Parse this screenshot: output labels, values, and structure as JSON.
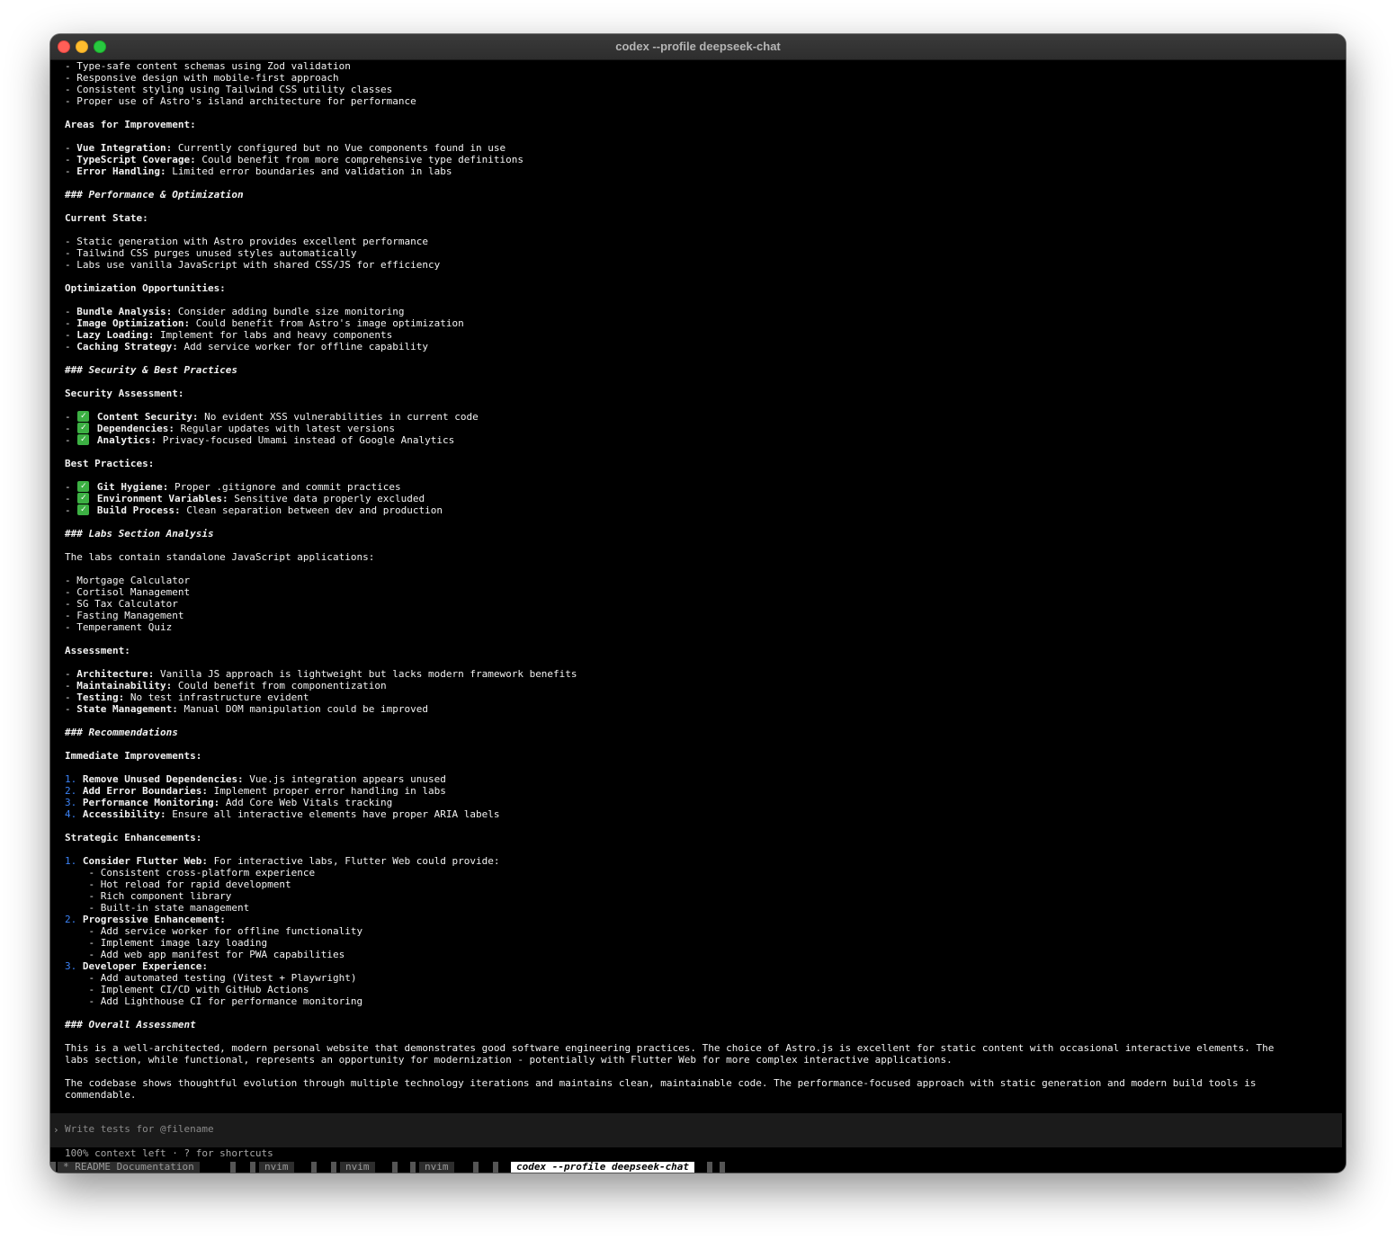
{
  "window": {
    "title": "codex --profile deepseek-chat"
  },
  "lines": [
    [
      {
        "t": "- Type-safe content schemas using Zod validation"
      }
    ],
    [
      {
        "t": "- Responsive design with mobile-first approach"
      }
    ],
    [
      {
        "t": "- Consistent styling using Tailwind CSS utility classes"
      }
    ],
    [
      {
        "t": "- Proper use of Astro's island architecture for performance"
      }
    ],
    [],
    [
      {
        "t": "Areas for Improvement:",
        "s": "b"
      }
    ],
    [],
    [
      {
        "t": "- "
      },
      {
        "t": "Vue Integration:",
        "s": "b"
      },
      {
        "t": " Currently configured but no Vue components found in use"
      }
    ],
    [
      {
        "t": "- "
      },
      {
        "t": "TypeScript Coverage:",
        "s": "b"
      },
      {
        "t": " Could benefit from more comprehensive type definitions"
      }
    ],
    [
      {
        "t": "- "
      },
      {
        "t": "Error Handling:",
        "s": "b"
      },
      {
        "t": " Limited error boundaries and validation in labs"
      }
    ],
    [],
    [
      {
        "t": "### Performance & Optimization",
        "s": "h"
      }
    ],
    [],
    [
      {
        "t": "Current State:",
        "s": "b"
      }
    ],
    [],
    [
      {
        "t": "- Static generation with Astro provides excellent performance"
      }
    ],
    [
      {
        "t": "- Tailwind CSS purges unused styles automatically"
      }
    ],
    [
      {
        "t": "- Labs use vanilla JavaScript with shared CSS/JS for efficiency"
      }
    ],
    [],
    [
      {
        "t": "Optimization Opportunities:",
        "s": "b"
      }
    ],
    [],
    [
      {
        "t": "- "
      },
      {
        "t": "Bundle Analysis:",
        "s": "b"
      },
      {
        "t": " Consider adding bundle size monitoring"
      }
    ],
    [
      {
        "t": "- "
      },
      {
        "t": "Image Optimization:",
        "s": "b"
      },
      {
        "t": " Could benefit from Astro's image optimization"
      }
    ],
    [
      {
        "t": "- "
      },
      {
        "t": "Lazy Loading:",
        "s": "b"
      },
      {
        "t": " Implement for labs and heavy components"
      }
    ],
    [
      {
        "t": "- "
      },
      {
        "t": "Caching Strategy:",
        "s": "b"
      },
      {
        "t": " Add service worker for offline capability"
      }
    ],
    [],
    [
      {
        "t": "### Security & Best Practices",
        "s": "h"
      }
    ],
    [],
    [
      {
        "t": "Security Assessment:",
        "s": "b"
      }
    ],
    [],
    [
      {
        "t": "- "
      },
      {
        "t": "✓",
        "s": "check"
      },
      {
        "t": " "
      },
      {
        "t": "Content Security:",
        "s": "b"
      },
      {
        "t": " No evident XSS vulnerabilities in current code"
      }
    ],
    [
      {
        "t": "- "
      },
      {
        "t": "✓",
        "s": "check"
      },
      {
        "t": " "
      },
      {
        "t": "Dependencies:",
        "s": "b"
      },
      {
        "t": " Regular updates with latest versions"
      }
    ],
    [
      {
        "t": "- "
      },
      {
        "t": "✓",
        "s": "check"
      },
      {
        "t": " "
      },
      {
        "t": "Analytics:",
        "s": "b"
      },
      {
        "t": " Privacy-focused Umami instead of Google Analytics"
      }
    ],
    [],
    [
      {
        "t": "Best Practices:",
        "s": "b"
      }
    ],
    [],
    [
      {
        "t": "- "
      },
      {
        "t": "✓",
        "s": "check"
      },
      {
        "t": " "
      },
      {
        "t": "Git Hygiene:",
        "s": "b"
      },
      {
        "t": " Proper .gitignore and commit practices"
      }
    ],
    [
      {
        "t": "- "
      },
      {
        "t": "✓",
        "s": "check"
      },
      {
        "t": " "
      },
      {
        "t": "Environment Variables:",
        "s": "b"
      },
      {
        "t": " Sensitive data properly excluded"
      }
    ],
    [
      {
        "t": "- "
      },
      {
        "t": "✓",
        "s": "check"
      },
      {
        "t": " "
      },
      {
        "t": "Build Process:",
        "s": "b"
      },
      {
        "t": " Clean separation between dev and production"
      }
    ],
    [],
    [
      {
        "t": "### Labs Section Analysis",
        "s": "h"
      }
    ],
    [],
    [
      {
        "t": "The labs contain standalone JavaScript applications:"
      }
    ],
    [],
    [
      {
        "t": "- Mortgage Calculator"
      }
    ],
    [
      {
        "t": "- Cortisol Management"
      }
    ],
    [
      {
        "t": "- SG Tax Calculator"
      }
    ],
    [
      {
        "t": "- Fasting Management"
      }
    ],
    [
      {
        "t": "- Temperament Quiz"
      }
    ],
    [],
    [
      {
        "t": "Assessment:",
        "s": "b"
      }
    ],
    [],
    [
      {
        "t": "- "
      },
      {
        "t": "Architecture:",
        "s": "b"
      },
      {
        "t": " Vanilla JS approach is lightweight but lacks modern framework benefits"
      }
    ],
    [
      {
        "t": "- "
      },
      {
        "t": "Maintainability:",
        "s": "b"
      },
      {
        "t": " Could benefit from componentization"
      }
    ],
    [
      {
        "t": "- "
      },
      {
        "t": "Testing:",
        "s": "b"
      },
      {
        "t": " No test infrastructure evident"
      }
    ],
    [
      {
        "t": "- "
      },
      {
        "t": "State Management:",
        "s": "b"
      },
      {
        "t": " Manual DOM manipulation could be improved"
      }
    ],
    [],
    [
      {
        "t": "### Recommendations",
        "s": "h"
      }
    ],
    [],
    [
      {
        "t": "Immediate Improvements:",
        "s": "b"
      }
    ],
    [],
    [
      {
        "t": "1.",
        "s": "num"
      },
      {
        "t": " "
      },
      {
        "t": "Remove Unused Dependencies:",
        "s": "b"
      },
      {
        "t": " Vue.js integration appears unused"
      }
    ],
    [
      {
        "t": "2.",
        "s": "num"
      },
      {
        "t": " "
      },
      {
        "t": "Add Error Boundaries:",
        "s": "b"
      },
      {
        "t": " Implement proper error handling in labs"
      }
    ],
    [
      {
        "t": "3.",
        "s": "num"
      },
      {
        "t": " "
      },
      {
        "t": "Performance Monitoring:",
        "s": "b"
      },
      {
        "t": " Add Core Web Vitals tracking"
      }
    ],
    [
      {
        "t": "4.",
        "s": "num"
      },
      {
        "t": " "
      },
      {
        "t": "Accessibility:",
        "s": "b"
      },
      {
        "t": " Ensure all interactive elements have proper ARIA labels"
      }
    ],
    [],
    [
      {
        "t": "Strategic Enhancements:",
        "s": "b"
      }
    ],
    [],
    [
      {
        "t": "1.",
        "s": "num"
      },
      {
        "t": " "
      },
      {
        "t": "Consider Flutter Web:",
        "s": "b"
      },
      {
        "t": " For interactive labs, Flutter Web could provide:"
      }
    ],
    [
      {
        "t": "    - Consistent cross-platform experience"
      }
    ],
    [
      {
        "t": "    - Hot reload for rapid development"
      }
    ],
    [
      {
        "t": "    - Rich component library"
      }
    ],
    [
      {
        "t": "    - Built-in state management"
      }
    ],
    [
      {
        "t": "2.",
        "s": "num"
      },
      {
        "t": " "
      },
      {
        "t": "Progressive Enhancement:",
        "s": "b"
      }
    ],
    [
      {
        "t": "    - Add service worker for offline functionality"
      }
    ],
    [
      {
        "t": "    - Implement image lazy loading"
      }
    ],
    [
      {
        "t": "    - Add web app manifest for PWA capabilities"
      }
    ],
    [
      {
        "t": "3.",
        "s": "num"
      },
      {
        "t": " "
      },
      {
        "t": "Developer Experience:",
        "s": "b"
      }
    ],
    [
      {
        "t": "    - Add automated testing (Vitest + Playwright)"
      }
    ],
    [
      {
        "t": "    - Implement CI/CD with GitHub Actions"
      }
    ],
    [
      {
        "t": "    - Add Lighthouse CI for performance monitoring"
      }
    ],
    [],
    [
      {
        "t": "### Overall Assessment",
        "s": "h"
      }
    ],
    [],
    [
      {
        "t": "This is a well-architected, modern personal website that demonstrates good software engineering practices. The choice of Astro.js is excellent for static content with occasional interactive elements. The"
      }
    ],
    [
      {
        "t": "labs section, while functional, represents an opportunity for modernization - potentially with Flutter Web for more complex interactive applications."
      }
    ],
    [],
    [
      {
        "t": "The codebase shows thoughtful evolution through multiple technology iterations and maintains clean, maintainable code. The performance-focused approach with static generation and modern build tools is"
      }
    ],
    [
      {
        "t": "commendable."
      }
    ]
  ],
  "composer": {
    "caret": "›",
    "placeholder": "Write tests for @filename"
  },
  "status_line": "100% context left · ? for shortcuts",
  "tabs": [
    {
      "label": "* README Documentation",
      "active": false
    },
    {
      "label": "nvim",
      "active": false
    },
    {
      "label": "nvim",
      "active": false
    },
    {
      "label": "nvim",
      "active": false
    },
    {
      "label": "codex --profile deepseek-chat",
      "active": true
    }
  ],
  "colors": {
    "background": "#000000",
    "text": "#f2f2f2",
    "list_number": "#3b82f6",
    "check_badge": "#3cb043"
  }
}
